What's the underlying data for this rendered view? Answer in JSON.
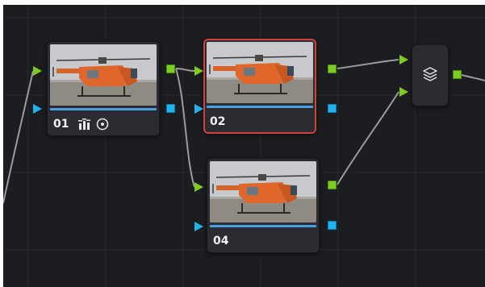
{
  "nodes": [
    {
      "id": "n01",
      "label": "01",
      "selected": false,
      "has_tool_icons": true
    },
    {
      "id": "n02",
      "label": "02",
      "selected": true,
      "has_tool_icons": false
    },
    {
      "id": "n04",
      "label": "04",
      "selected": false,
      "has_tool_icons": false
    }
  ],
  "layer_mixer": {
    "icon": "layers-icon"
  },
  "icons": {
    "node01_tools": [
      "chart-bars-icon",
      "circle-target-icon"
    ]
  },
  "colors": {
    "canvas_bg": "#1c1d21",
    "node_bg": "#2b2c31",
    "selected_outline": "#d2413d",
    "rgb_port": "#7ccc22",
    "alpha_port": "#1fb3ee",
    "wire": "#9b9b9b"
  }
}
